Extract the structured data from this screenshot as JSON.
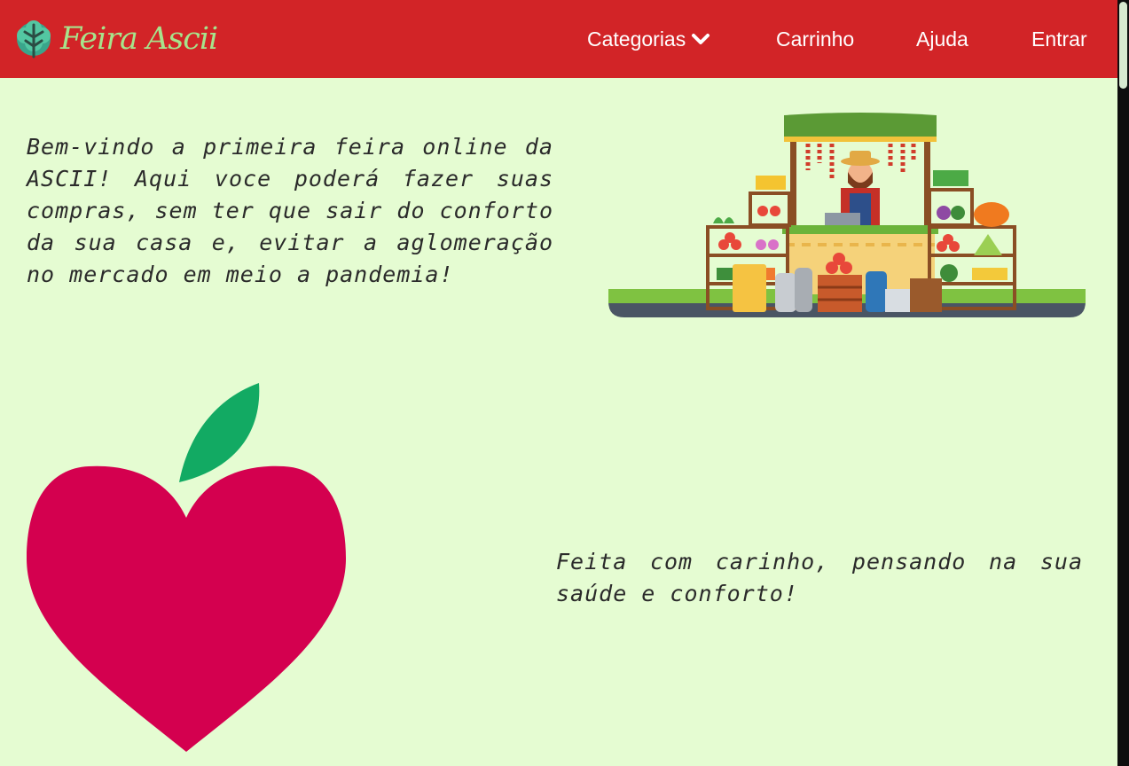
{
  "nav": {
    "brand": "Feira Ascii",
    "categories_label": "Categorias",
    "cart_label": "Carrinho",
    "help_label": "Ajuda",
    "login_label": "Entrar"
  },
  "hero": {
    "welcome_text": "Bem-vindo a primeira feira online da ASCII! Aqui voce poderá fazer suas compras, sem ter que sair do conforto da sua casa e, evitar a aglomeração no mercado em meio a pandemia!"
  },
  "section2": {
    "made_text": "Feita com carinho, pensando na sua saúde e conforto!"
  },
  "icons": {
    "brand": "leaf-icon",
    "dropdown": "chevron-down-icon"
  },
  "colors": {
    "navbar": "#d22427",
    "background": "#e5fcd2",
    "brand_text": "#a7e38c",
    "apple": "#d4004f",
    "leaf": "#12aa63"
  }
}
